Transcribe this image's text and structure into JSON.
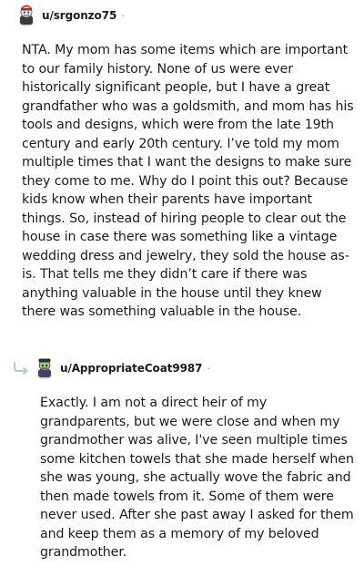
{
  "comments": [
    {
      "username": "u/srgonzo75",
      "separator": "·",
      "body": "NTA. My mom has some items which are important\nto our family history. None of us were ever\nhistorically significant people, but I have a great\ngrandfather who was a goldsmith, and mom has his\ntools and designs, which were from the late 19th\ncentury and early 20th century. I’ve told my mom\nmultiple times that I want the designs to make sure\nthey come to me. Why do I point this out? Because\nkids know when their parents have important\nthings. So, instead of hiring people to clear out the\nhouse in case there was something like a vintage\nwedding dress and jewelry, they sold the house as-\nis. That tells me they didn’t care if there was\nanything valuable in the house until they knew\nthere was something valuable in the house."
    },
    {
      "username": "u/AppropriateCoat9987",
      "separator": "·",
      "body": "Exactly. I am not a direct heir of my\ngrandparents, but we were close and when my\ngrandmother was alive, I've seen multiple times\nsome kitchen towels that she made herself when\nshe was young, she actually wove the fabric and\nthen made towels from it. Some of them were\nnever used. After she past away I asked for them\nand keep them as a memory of my beloved\ngrandmother."
    }
  ]
}
